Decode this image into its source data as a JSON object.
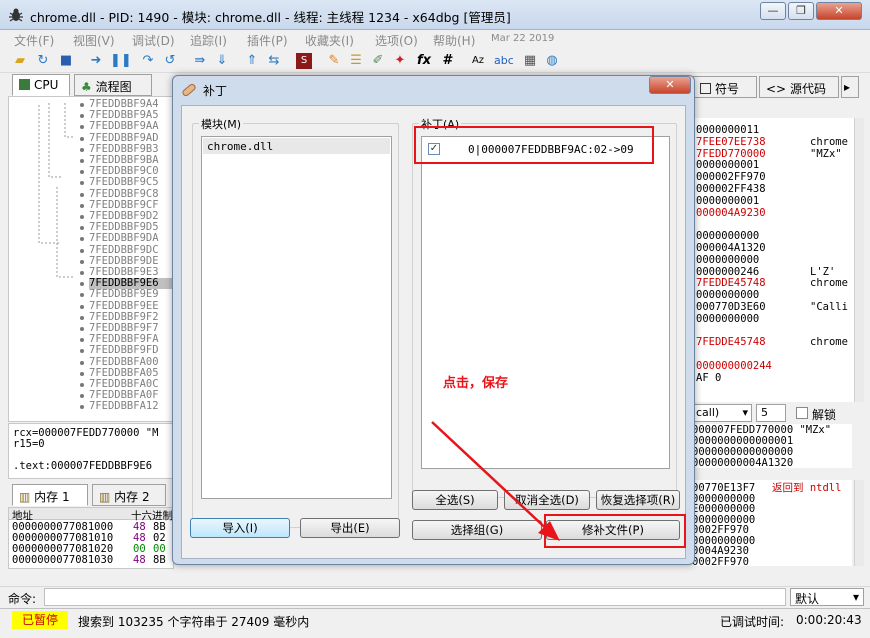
{
  "window": {
    "title": "chrome.dll - PID: 1490 - 模块: chrome.dll - 线程: 主线程 1234 - x64dbg [管理员]",
    "minimize": "—",
    "restore": "❐",
    "close": "✕"
  },
  "menu": [
    "文件(F)",
    "视图(V)",
    "调试(D)",
    "追踪(I)",
    "插件(P)",
    "收藏夹(I)",
    "选项(O)",
    "帮助(H)",
    "Mar 22 2019"
  ],
  "toolbar_icons": [
    "open-icon",
    "restart-icon",
    "stop-icon",
    "run-icon",
    "pause-icon",
    "step-into-icon",
    "step-over-icon",
    "trace-into-icon",
    "trace-over-icon",
    "execute-till-return-icon",
    "run-to-user-code-icon",
    "scylla-icon",
    "patch-icon",
    "comment-icon",
    "label-icon",
    "bookmark-icon",
    "function-icon",
    "hash-icon",
    "font-icon",
    "strings-icon",
    "calculator-icon",
    "globe-icon"
  ],
  "main_tabs": {
    "cpu": "CPU",
    "graph": "流程图",
    "symbols": "符号",
    "source": "源代码"
  },
  "disasm": {
    "addresses": [
      "7FEDDBBF9A4",
      "7FEDDBBF9A5",
      "7FEDDBBF9AA",
      "7FEDDBBF9AD",
      "7FEDDBBF9B3",
      "7FEDDBBF9BA",
      "7FEDDBBF9C0",
      "7FEDDBBF9C5",
      "7FEDDBBF9C8",
      "7FEDDBBF9CF",
      "7FEDDBBF9D2",
      "7FEDDBBF9D5",
      "7FEDDBBF9DA",
      "7FEDDBBF9DC",
      "7FEDDBBF9DE",
      "7FEDDBBF9E3",
      "7FEDDBBF9E6",
      "7FEDDBBF9E9",
      "7FEDDBBF9EE",
      "7FEDDBBF9F2",
      "7FEDDBBF9F7",
      "7FEDDBBF9FA",
      "7FEDDBBF9FD",
      "7FEDDBBFA00",
      "7FEDDBBFA05",
      "7FEDDBBFA0C",
      "7FEDDBBFA0F",
      "7FEDDBBFA12"
    ],
    "selected_index": 16
  },
  "regs_lines": [
    "rcx=000007FEDD770000 \"M",
    "r15=0",
    "",
    ".text:000007FEDDBBF9E6"
  ],
  "mem_tabs": {
    "mem1": "内存 1",
    "mem2": "内存 2"
  },
  "mem": {
    "header_addr": "地址",
    "header_hex": "十六进制",
    "rows": [
      {
        "addr": "0000000077081000",
        "b1": "48",
        "b2": "8B"
      },
      {
        "addr": "0000000077081010",
        "b1": "48",
        "b2": "02"
      },
      {
        "addr": "0000000077081020",
        "b1": "00",
        "b2": "00"
      },
      {
        "addr": "0000000077081030",
        "b1": "48",
        "b2": "8B"
      }
    ]
  },
  "right_regs": [
    {
      "v": "0000000011",
      "c": "",
      "red": false
    },
    {
      "v": "7FEE07EE738",
      "c": "chrome",
      "red": true
    },
    {
      "v": "7FEDD770000",
      "c": "\"MZx\"",
      "red": true
    },
    {
      "v": "0000000001",
      "c": "",
      "red": false
    },
    {
      "v": "000002FF970",
      "c": "",
      "red": false
    },
    {
      "v": "000002FF438",
      "c": "",
      "red": false
    },
    {
      "v": "0000000001",
      "c": "",
      "red": false
    },
    {
      "v": "000004A9230",
      "c": "",
      "red": true
    },
    {
      "v": "",
      "c": "",
      "red": false
    },
    {
      "v": "0000000000",
      "c": "",
      "red": false
    },
    {
      "v": "000004A1320",
      "c": "",
      "red": false
    },
    {
      "v": "0000000000",
      "c": "",
      "red": false
    },
    {
      "v": "0000000246",
      "c": "L'Z'",
      "red": false
    },
    {
      "v": "7FEDDE45748",
      "c": "chrome",
      "red": true
    },
    {
      "v": "0000000000",
      "c": "",
      "red": false
    },
    {
      "v": "000770D3E60",
      "c": "\"Calli",
      "red": false
    },
    {
      "v": "0000000000",
      "c": "",
      "red": false
    },
    {
      "v": "",
      "c": "",
      "red": false
    },
    {
      "v": "7FEDDE45748",
      "c": "chrome",
      "red": true
    },
    {
      "v": "",
      "c": "",
      "red": false
    },
    {
      "v": "000000000244",
      "c": "",
      "red": true
    },
    {
      "v": "AF 0",
      "c": "",
      "red": false
    },
    {
      "v": "",
      "c": "",
      "red": false
    }
  ],
  "call_bar": {
    "conv": "call)",
    "count": "5",
    "unlock": "解锁"
  },
  "stack_lines": [
    "000007FEDD770000 \"MZx\"",
    "0000000000000001",
    "0000000000000000",
    "00000000004A1320"
  ],
  "stack2_lines": [
    {
      "v": "00770E13F7",
      "c": "返回到 ntdll"
    },
    {
      "v": "0000000000",
      "c": ""
    },
    {
      "v": "E000000000",
      "c": ""
    },
    {
      "v": "0000000000",
      "c": ""
    },
    {
      "v": "0002FF970",
      "c": ""
    },
    {
      "v": "0000000000",
      "c": ""
    },
    {
      "v": "0004A9230",
      "c": ""
    },
    {
      "v": "0002FF970",
      "c": ""
    }
  ],
  "dialog": {
    "title": "补丁",
    "modules_label": "模块(M)",
    "modules": [
      "chrome.dll"
    ],
    "patches_label": "补丁(A)",
    "patches": [
      {
        "checked": true,
        "text": "0|000007FEDDBBF9AC:02->09"
      }
    ],
    "select_all": "全选(S)",
    "deselect_all": "取消全选(D)",
    "restore_selection": "恢复选择项(R)",
    "select_group": "选择组(G)",
    "patch_file": "修补文件(P)",
    "import": "导入(I)",
    "export": "导出(E)",
    "close": "✕"
  },
  "annotation": "点击，保存",
  "command": {
    "label": "命令:",
    "mode": "默认"
  },
  "status": {
    "state": "已暂停",
    "message": "搜索到 103235 个字符串于 27409 毫秒内",
    "time_label": "已调试时间:",
    "time": "0:00:20:43"
  },
  "colors": {
    "accent_red": "#e8141a",
    "paused_bg": "#ffff00",
    "paused_text": "#cc0000",
    "reg_red": "#cc0000"
  }
}
